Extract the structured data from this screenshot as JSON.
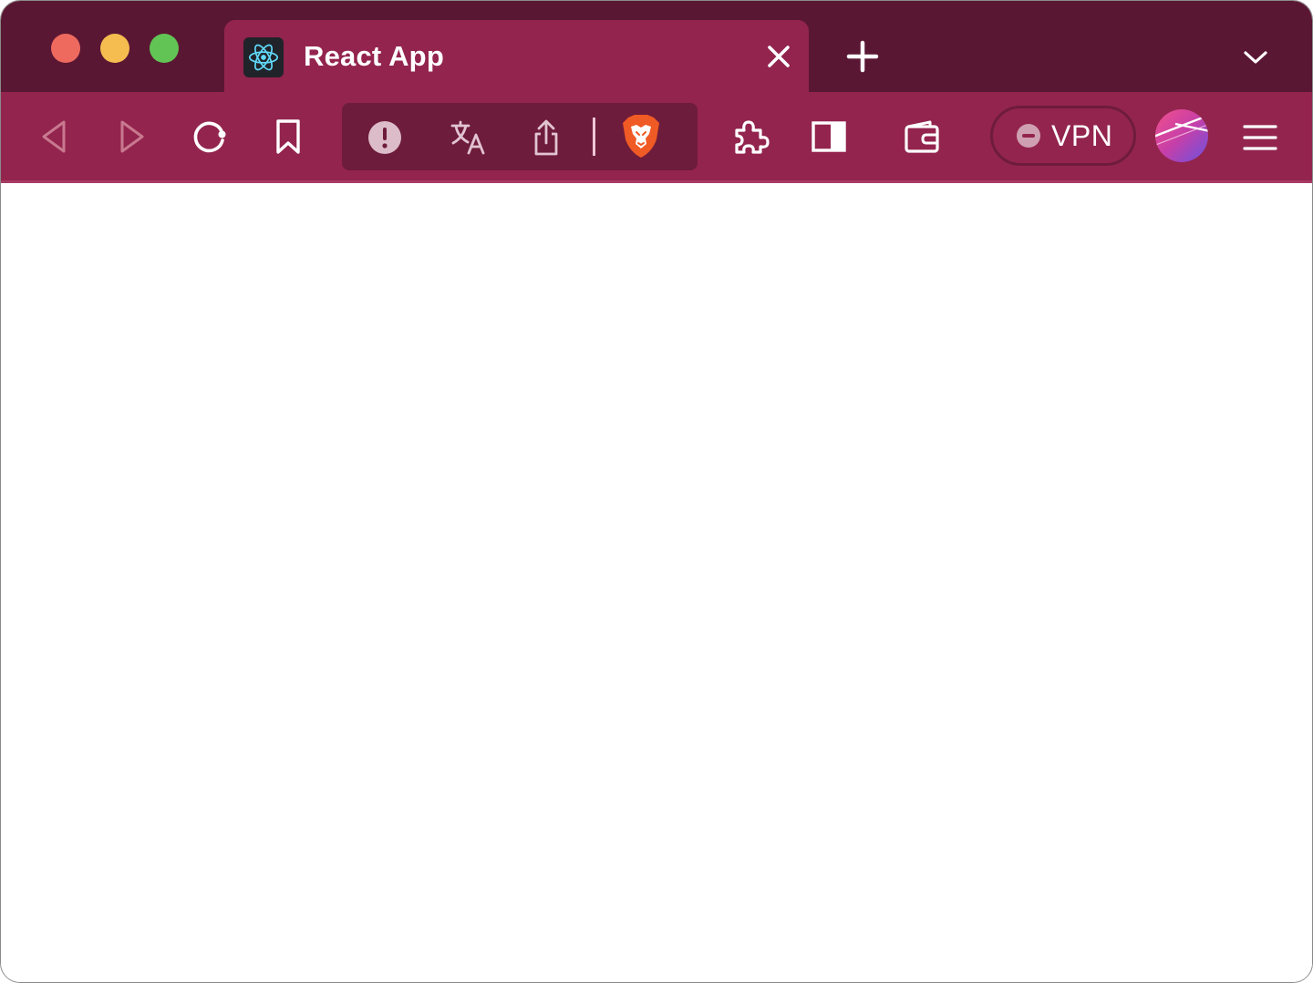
{
  "window": {
    "traffic_lights": [
      {
        "name": "close",
        "color": "#ee6a5e"
      },
      {
        "name": "minimize",
        "color": "#f5bd4f"
      },
      {
        "name": "maximize",
        "color": "#61c454"
      }
    ]
  },
  "colors": {
    "tabbar_background": "#5a1733",
    "toolbar_background": "#93244e",
    "address_pill_background": "#6e1c3b",
    "content_background": "#ffffff"
  },
  "tabs": [
    {
      "title": "React App",
      "favicon": "react-logo-icon",
      "active": true
    }
  ],
  "icons": {
    "tab_close": "close-icon",
    "new_tab": "plus-icon",
    "tab_list": "chevron-down-icon",
    "back": "back-triangle-icon",
    "forward": "forward-triangle-icon",
    "reload": "reload-icon",
    "bookmark": "bookmark-icon",
    "site_info": "warning-circle-icon",
    "translate": "translate-icon",
    "share": "share-icon",
    "shields": "brave-lion-icon",
    "extensions": "puzzle-icon",
    "sidebar": "sidebar-icon",
    "wallet": "wallet-icon",
    "menu": "hamburger-menu-icon"
  },
  "toolbar": {
    "vpn_label": "VPN"
  }
}
